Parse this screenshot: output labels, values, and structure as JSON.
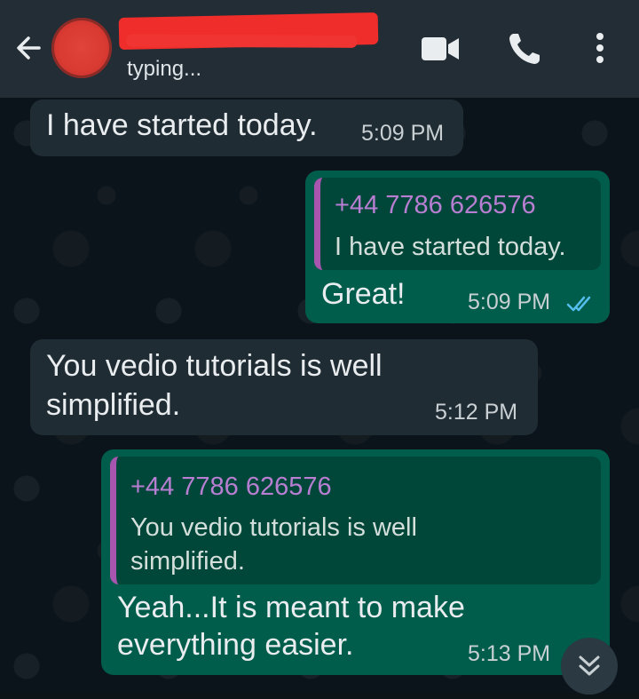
{
  "header": {
    "contact_status": "typing...",
    "icons": [
      "back-arrow-icon",
      "video-call-icon",
      "phone-icon",
      "more-vertical-icon"
    ]
  },
  "messages": [
    {
      "direction": "incoming",
      "text": "I have started today.",
      "time": "5:09 PM"
    },
    {
      "direction": "outgoing",
      "quote_sender": "+44 7786 626576",
      "quote_text": "I have started today.",
      "text": "Great!",
      "time": "5:09 PM",
      "read": true
    },
    {
      "direction": "incoming",
      "text_line1": "You vedio tutorials is well",
      "text_line2": "simplified.",
      "time": "5:12 PM"
    },
    {
      "direction": "outgoing",
      "quote_sender": "+44 7786 626576",
      "quote_line1": "You vedio tutorials is well",
      "quote_line2": "simplified.",
      "text_line1": "Yeah...It is meant to make",
      "text_line2": "everything easier.",
      "time": "5:13 PM"
    }
  ],
  "colors": {
    "header": "#232d36",
    "incoming_bubble": "#202c33",
    "outgoing_bubble": "#005c4b",
    "quote_bar": "#a855b0",
    "read_ticks": "#53bdeb"
  }
}
